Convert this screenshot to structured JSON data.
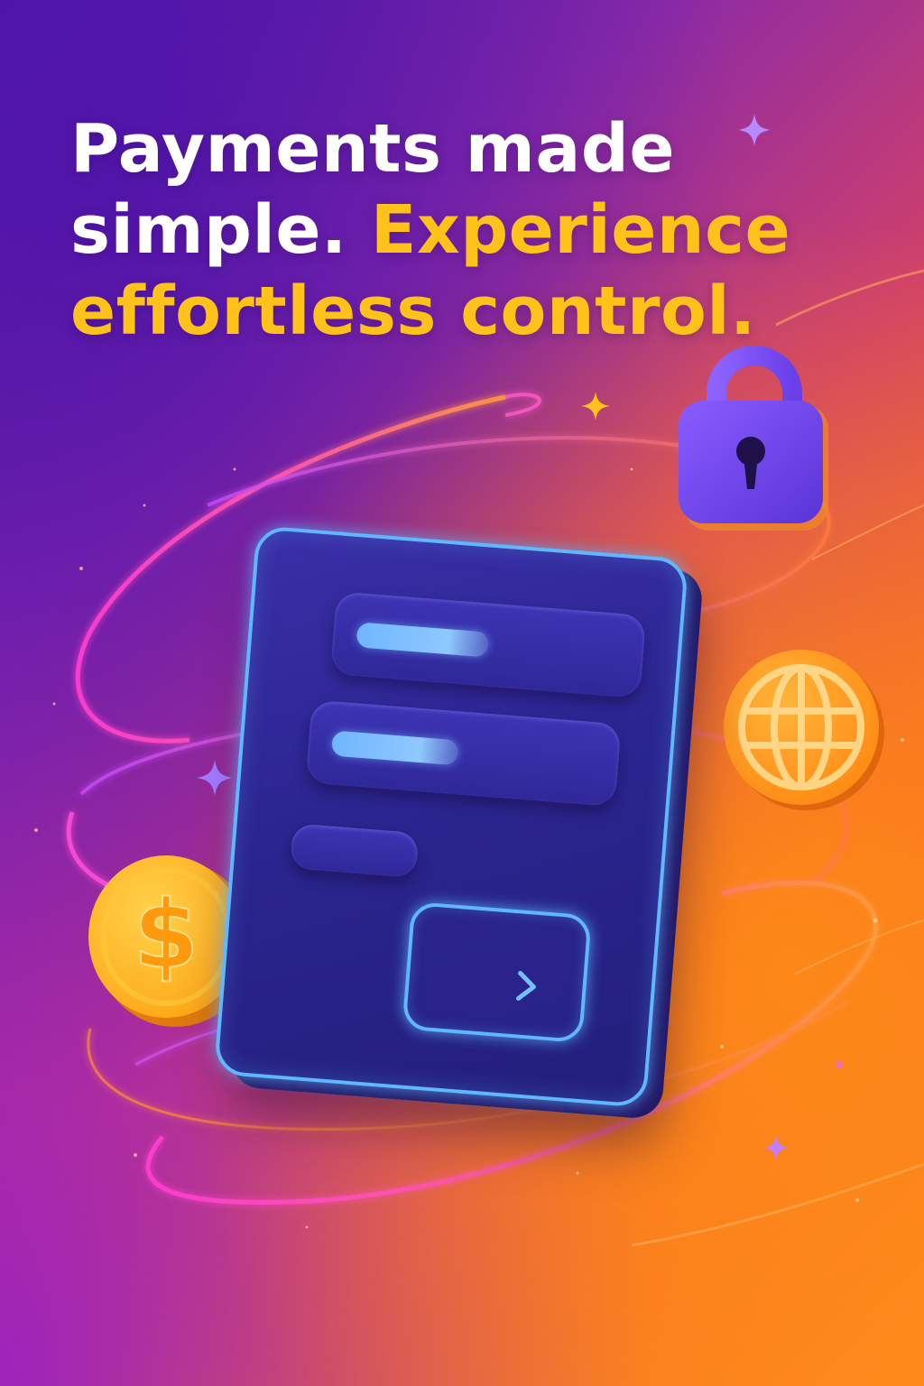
{
  "headline": {
    "line_1": "Payments made",
    "line_2_white": "simple.",
    "line_2_accent": "Experience",
    "line_3_accent": "effortless control."
  },
  "colors": {
    "headline_white": "#ffffff",
    "headline_accent": "#ffc21a",
    "card_border_glow": "#5fb8ff",
    "card_fill": "#2b2590",
    "coin_gold": "#ffb21a",
    "globe_orange": "#ff9a1e",
    "lock_purple": "#7a4cf0"
  },
  "icons": {
    "lock": "lock-icon",
    "globe": "globe-icon",
    "coin": "dollar-coin-icon",
    "submit": "chevron-right-icon",
    "sparkles": "sparkle-icon"
  },
  "card": {
    "fields": [
      {
        "name": "field-1",
        "fill_fraction": 0.5
      },
      {
        "name": "field-2",
        "fill_fraction": 0.48
      },
      {
        "name": "field-3",
        "fill_fraction": 0.0
      }
    ]
  },
  "coin": {
    "symbol": "$"
  }
}
